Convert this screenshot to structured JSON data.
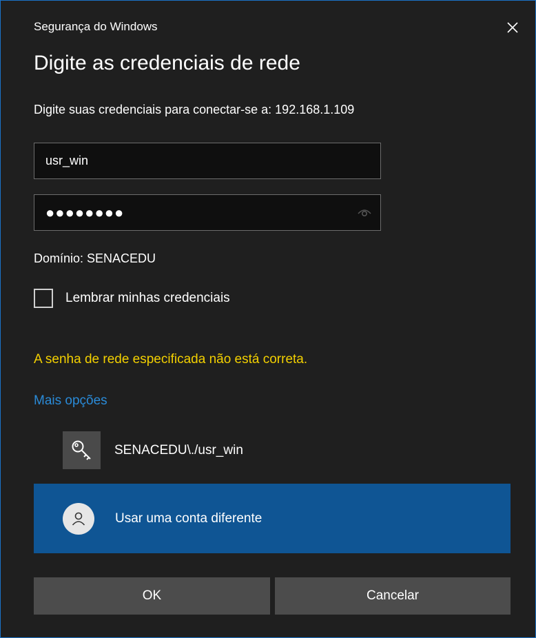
{
  "window": {
    "title": "Segurança do Windows",
    "close_icon": "close-icon"
  },
  "heading": "Digite as credenciais de rede",
  "subtitle": "Digite suas credenciais para conectar-se a: 192.168.1.109",
  "username": {
    "value": "usr_win"
  },
  "password": {
    "masked_value": "●●●●●●●●",
    "reveal_icon": "eye-icon"
  },
  "domain": "Domínio: SENACEDU",
  "remember": {
    "label": "Lembrar minhas credenciais",
    "checked": false
  },
  "error_message": "A senha de rede especificada não está correta.",
  "more_options": "Mais opções",
  "accounts": {
    "saved_account": {
      "label": "SENACEDU\\./usr_win",
      "icon": "key-icon"
    },
    "other_account": {
      "label": "Usar uma conta diferente",
      "icon": "person-icon"
    }
  },
  "buttons": {
    "ok": "OK",
    "cancel": "Cancelar"
  },
  "colors": {
    "background": "#1f1f1f",
    "accent": "#0f5594",
    "link": "#2a8bd8",
    "error": "#f3d000",
    "button": "#4c4c4c"
  }
}
